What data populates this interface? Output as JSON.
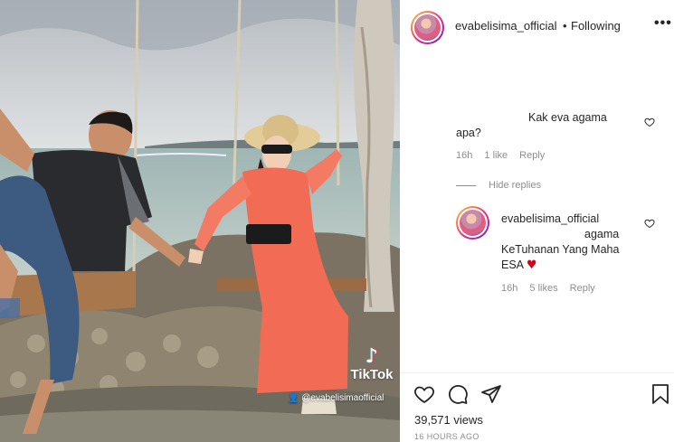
{
  "video": {
    "watermark": "TikTok",
    "handle": "@evabelisimaofficial"
  },
  "header": {
    "username": "evabelisima_official",
    "separator": "•",
    "follow_status": "Following",
    "more_icon": "more-horizontal-icon"
  },
  "comments": [
    {
      "text_part1": "Kak eva agama",
      "text_part2": "apa?",
      "time": "16h",
      "likes": "1 like",
      "reply": "Reply"
    }
  ],
  "hide_replies": "Hide replies",
  "reply": {
    "username": "evabelisima_official",
    "text_part1": "agama",
    "text_part2": "KeTuhanan Yang Maha",
    "text_part3": "ESA",
    "emoji": "♥",
    "time": "16h",
    "likes": "5 likes",
    "reply": "Reply"
  },
  "actions": {
    "like_icon": "heart-icon",
    "comment_icon": "comment-icon",
    "share_icon": "share-icon",
    "save_icon": "bookmark-icon"
  },
  "views": "39,571 views",
  "posted": "16 HOURS AGO",
  "colors": {
    "text": "#262626",
    "secondary": "#8e8e8e",
    "heart_emoji": "#d0021b",
    "dress": "#f26b55"
  }
}
